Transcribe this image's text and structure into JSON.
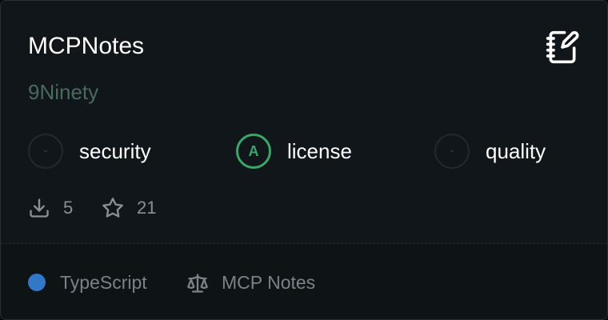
{
  "card": {
    "title": "MCPNotes",
    "author": "9Ninety",
    "header_icon": "notebook-pen-icon"
  },
  "scores": [
    {
      "grade": "-",
      "label": "security"
    },
    {
      "grade": "A",
      "label": "license"
    },
    {
      "grade": "-",
      "label": "quality"
    }
  ],
  "stats": {
    "downloads": "5",
    "stars": "21",
    "download_icon": "download-icon",
    "star_icon": "star-icon"
  },
  "footer": {
    "language": "TypeScript",
    "language_color": "#3178c6",
    "license": "MCP Notes",
    "license_icon": "scale-icon"
  },
  "colors": {
    "grade_a": "#3aa66a",
    "author": "#4a6a5e",
    "card_bg": "#101619"
  }
}
